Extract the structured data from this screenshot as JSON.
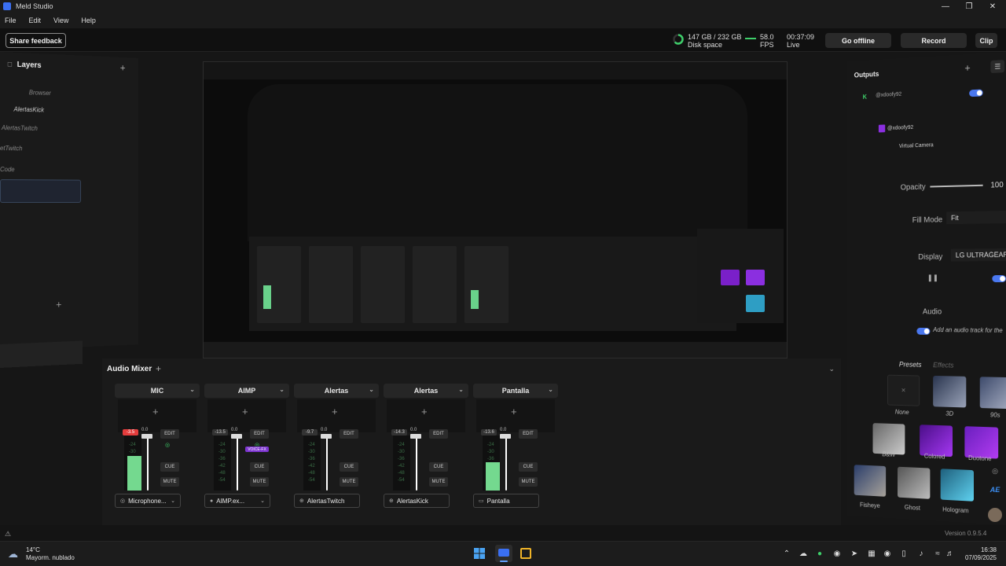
{
  "window": {
    "title": "Meld Studio"
  },
  "menu": [
    "File",
    "Edit",
    "View",
    "Help"
  ],
  "topbar": {
    "share_feedback": "Share feedback",
    "disk_value": "147 GB / 232 GB",
    "disk_label": "Disk space",
    "fps_value": "58.0",
    "fps_label": "FPS",
    "live_time": "00:37:09",
    "live_label": "Live",
    "go_offline": "Go offline",
    "record": "Record",
    "clip": "Clip"
  },
  "layers": {
    "title": "Layers",
    "items": [
      "Browser",
      "AlertasKick",
      "AlertasTwitch",
      "etTwitch",
      "Code"
    ]
  },
  "mixer": {
    "title": "Audio Mixer",
    "strips": [
      {
        "name": "MIC",
        "db": "-3.5",
        "level": 0.66,
        "source": "Microphone...",
        "source_icon": "mic-icon",
        "red": true
      },
      {
        "name": "AIMP",
        "db": "-13.5",
        "level": 0.0,
        "source": "AIMP.ex...",
        "source_icon": "app-icon",
        "red": false,
        "tag": "VOICE-FX"
      },
      {
        "name": "Alertas",
        "db": "-9.7",
        "level": 0.0,
        "source": "AlertasTwitch",
        "source_icon": "globe-icon",
        "red": false
      },
      {
        "name": "Alertas",
        "db": "-14.3",
        "level": 0.0,
        "source": "AlertasKick",
        "source_icon": "globe-icon",
        "red": false
      },
      {
        "name": "Pantalla",
        "db": "-13.6",
        "level": 0.55,
        "source": "Pantalla",
        "source_icon": "monitor-icon",
        "red": false
      }
    ],
    "edit": "EDIT",
    "cue": "CUE",
    "mute": "MUTE",
    "fader_db": "0.0",
    "ticks": [
      "-24",
      "-30",
      "-36",
      "-42",
      "-48",
      "-54"
    ]
  },
  "outputs": {
    "title": "Outputs",
    "items": [
      "@xdoofy92",
      "@xdoofy92",
      "Virtual Camera"
    ],
    "opacity_label": "Opacity",
    "opacity_value": "100",
    "fill_mode_label": "Fill Mode",
    "fill_mode_value": "Fit",
    "display_label": "Display",
    "display_value": "LG ULTRAGEAR",
    "audio_label": "Audio",
    "audio_track": "Add an audio track for the",
    "tab_presets": "Presets",
    "tab_effects": "Effects",
    "presets": [
      "None",
      "3D",
      "90s",
      "B&W",
      "Colored",
      "Duotone",
      "Fisheye",
      "Ghost",
      "Hologram"
    ]
  },
  "version": "Version 0.9.5.4",
  "taskbar": {
    "temp": "14°C",
    "weather": "Mayorm. nublado",
    "time": "16:38",
    "date": "07/09/2025"
  },
  "colors": {
    "accent": "#4a78f0",
    "meter_green": "#74d98f",
    "clip_red": "#e33c3c",
    "purple": "#8b2fe0"
  }
}
